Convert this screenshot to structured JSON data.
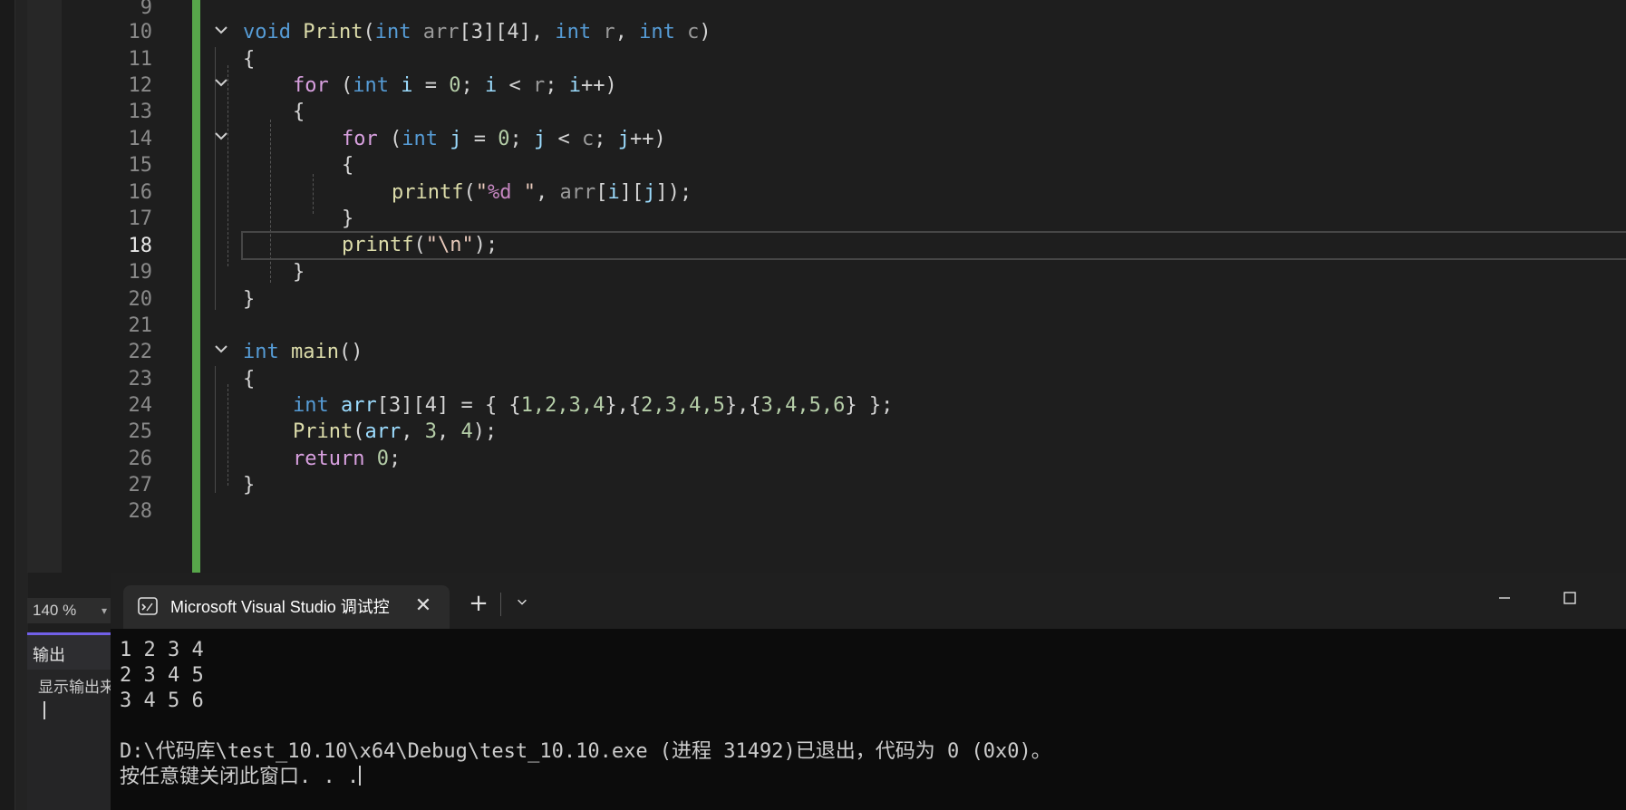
{
  "editor": {
    "zoom": "140 %",
    "current_line": 18,
    "line_numbers": [
      "9",
      "10",
      "11",
      "12",
      "13",
      "14",
      "15",
      "16",
      "17",
      "18",
      "19",
      "20",
      "21",
      "22",
      "23",
      "24",
      "25",
      "26",
      "27",
      "28"
    ],
    "lines": {
      "l10": [
        [
          "void ",
          "kw-blue"
        ],
        [
          "Print",
          "fn"
        ],
        [
          "(",
          "punct"
        ],
        [
          "int ",
          "kw-blue"
        ],
        [
          "arr",
          "param"
        ],
        [
          "[3][4], ",
          "punct"
        ],
        [
          "int ",
          "kw-blue"
        ],
        [
          "r",
          "param"
        ],
        [
          ", ",
          "punct"
        ],
        [
          "int ",
          "kw-blue"
        ],
        [
          "c",
          "param"
        ],
        [
          ")",
          "punct"
        ]
      ],
      "l11": [
        [
          "{",
          "punct"
        ]
      ],
      "l12": [
        [
          "for ",
          "kw-purple"
        ],
        [
          "(",
          "punct"
        ],
        [
          "int ",
          "kw-blue"
        ],
        [
          "i ",
          "var"
        ],
        [
          "= ",
          "punct"
        ],
        [
          "0",
          "num"
        ],
        [
          "; ",
          "punct"
        ],
        [
          "i ",
          "var"
        ],
        [
          "< ",
          "punct"
        ],
        [
          "r",
          "param"
        ],
        [
          "; ",
          "punct"
        ],
        [
          "i",
          "var"
        ],
        [
          "++)",
          "punct"
        ]
      ],
      "l13": [
        [
          "{",
          "punct"
        ]
      ],
      "l14": [
        [
          "for ",
          "kw-purple"
        ],
        [
          "(",
          "punct"
        ],
        [
          "int ",
          "kw-blue"
        ],
        [
          "j ",
          "var"
        ],
        [
          "= ",
          "punct"
        ],
        [
          "0",
          "num"
        ],
        [
          "; ",
          "punct"
        ],
        [
          "j ",
          "var"
        ],
        [
          "< ",
          "punct"
        ],
        [
          "c",
          "param"
        ],
        [
          "; ",
          "punct"
        ],
        [
          "j",
          "var"
        ],
        [
          "++)",
          "punct"
        ]
      ],
      "l15": [
        [
          "{",
          "punct"
        ]
      ],
      "l16": [
        [
          "printf",
          "fn"
        ],
        [
          "(",
          "punct"
        ],
        [
          "\"",
          "str"
        ],
        [
          "%d",
          "fmt"
        ],
        [
          " \"",
          "str"
        ],
        [
          ", ",
          "punct"
        ],
        [
          "arr",
          "param"
        ],
        [
          "[",
          "punct"
        ],
        [
          "i",
          "var"
        ],
        [
          "][",
          "punct"
        ],
        [
          "j",
          "var"
        ],
        [
          "]);",
          "punct"
        ]
      ],
      "l17": [
        [
          "}",
          "punct"
        ]
      ],
      "l18": [
        [
          "printf",
          "fn"
        ],
        [
          "(",
          "punct"
        ],
        [
          "\"",
          "str"
        ],
        [
          "\\n",
          "esc"
        ],
        [
          "\"",
          "str"
        ],
        [
          ");",
          "punct"
        ]
      ],
      "l19": [
        [
          "}",
          "punct"
        ]
      ],
      "l20": [
        [
          "}",
          "punct"
        ]
      ],
      "l22": [
        [
          "int ",
          "kw-blue"
        ],
        [
          "main",
          "fn"
        ],
        [
          "()",
          "punct"
        ]
      ],
      "l23": [
        [
          "{",
          "punct"
        ]
      ],
      "l24": [
        [
          "int ",
          "kw-blue"
        ],
        [
          "arr",
          "var"
        ],
        [
          "[3][4] = { {",
          "punct"
        ],
        [
          "1,2,3,4",
          "num"
        ],
        [
          "},{",
          "punct"
        ],
        [
          "2,3,4,5",
          "num"
        ],
        [
          "},{",
          "punct"
        ],
        [
          "3,4,5,6",
          "num"
        ],
        [
          "} };",
          "punct"
        ]
      ],
      "l25": [
        [
          "Print",
          "fn"
        ],
        [
          "(",
          "punct"
        ],
        [
          "arr",
          "var"
        ],
        [
          ", ",
          "punct"
        ],
        [
          "3",
          "num"
        ],
        [
          ", ",
          "punct"
        ],
        [
          "4",
          "num"
        ],
        [
          ");",
          "punct"
        ]
      ],
      "l26": [
        [
          "return ",
          "kw-purple"
        ],
        [
          "0",
          "num"
        ],
        [
          ";",
          "punct"
        ]
      ],
      "l27": [
        [
          "}",
          "punct"
        ]
      ]
    }
  },
  "output_panel": {
    "tab_label": "输出",
    "show_label": "显示输出来"
  },
  "terminal": {
    "tab_title": "Microsoft Visual Studio 调试控",
    "close_glyph": "✕",
    "new_tab_glyph": "+",
    "dropdown_glyph": "⌄",
    "lines": [
      "1 2 3 4",
      "2 3 4 5",
      "3 4 5 6",
      "",
      "D:\\代码库\\test_10.10\\x64\\Debug\\test_10.10.exe (进程 31492)已退出，代码为 0 (0x0)。",
      "按任意键关闭此窗口. . ."
    ],
    "colors": {
      "background": "#0c0c0c",
      "titlebar": "#1f1f1f",
      "tab": "#2b2b2b"
    }
  },
  "colors": {
    "change_bar": "#57a64a",
    "keyword": "#569cd6",
    "control": "#d8a0df",
    "function": "#dcdcaa",
    "number": "#b5cea8"
  }
}
